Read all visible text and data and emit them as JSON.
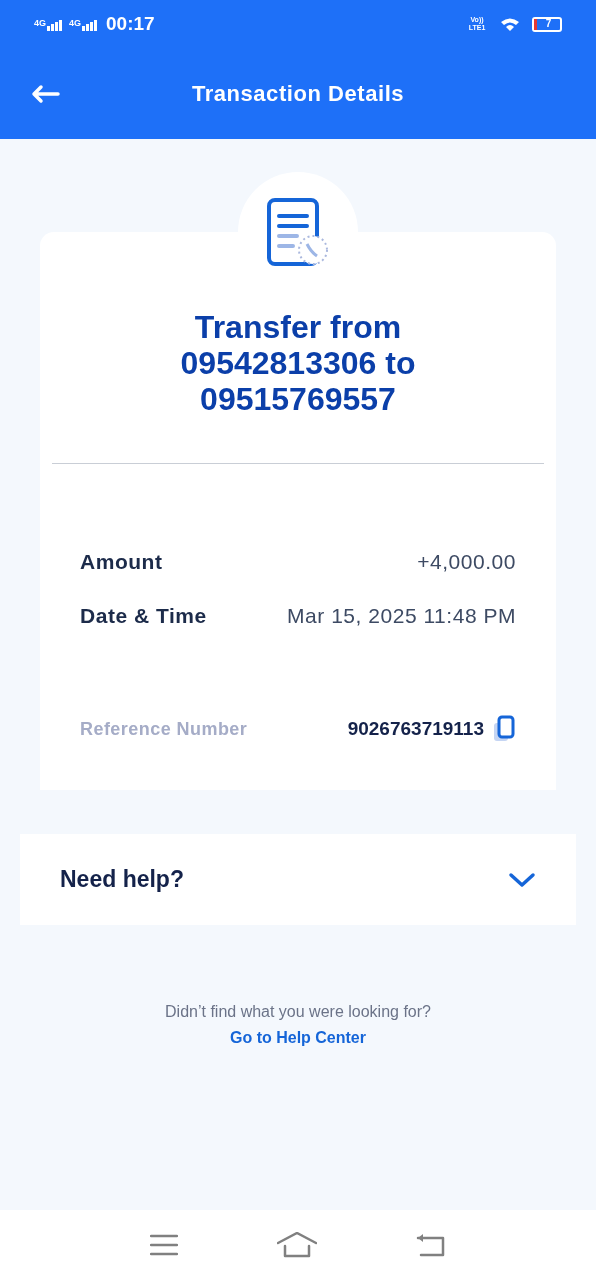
{
  "status_bar": {
    "networks": [
      "4G",
      "4G"
    ],
    "time": "00:17",
    "volte": "Vo)) LTE1",
    "battery": "7"
  },
  "header": {
    "title": "Transaction Details"
  },
  "receipt": {
    "title": "Transfer from 09542813306 to 09515769557",
    "rows": [
      {
        "label": "Amount",
        "value": "+4,000.00"
      },
      {
        "label": "Date & Time",
        "value": "Mar 15, 2025 11:48 PM"
      }
    ],
    "reference": {
      "label": "Reference Number",
      "value": "9026763719113"
    }
  },
  "help": {
    "title": "Need help?",
    "expanded": false
  },
  "footer": {
    "text": "Didn’t find what you were looking for?",
    "link": "Go to Help Center"
  }
}
